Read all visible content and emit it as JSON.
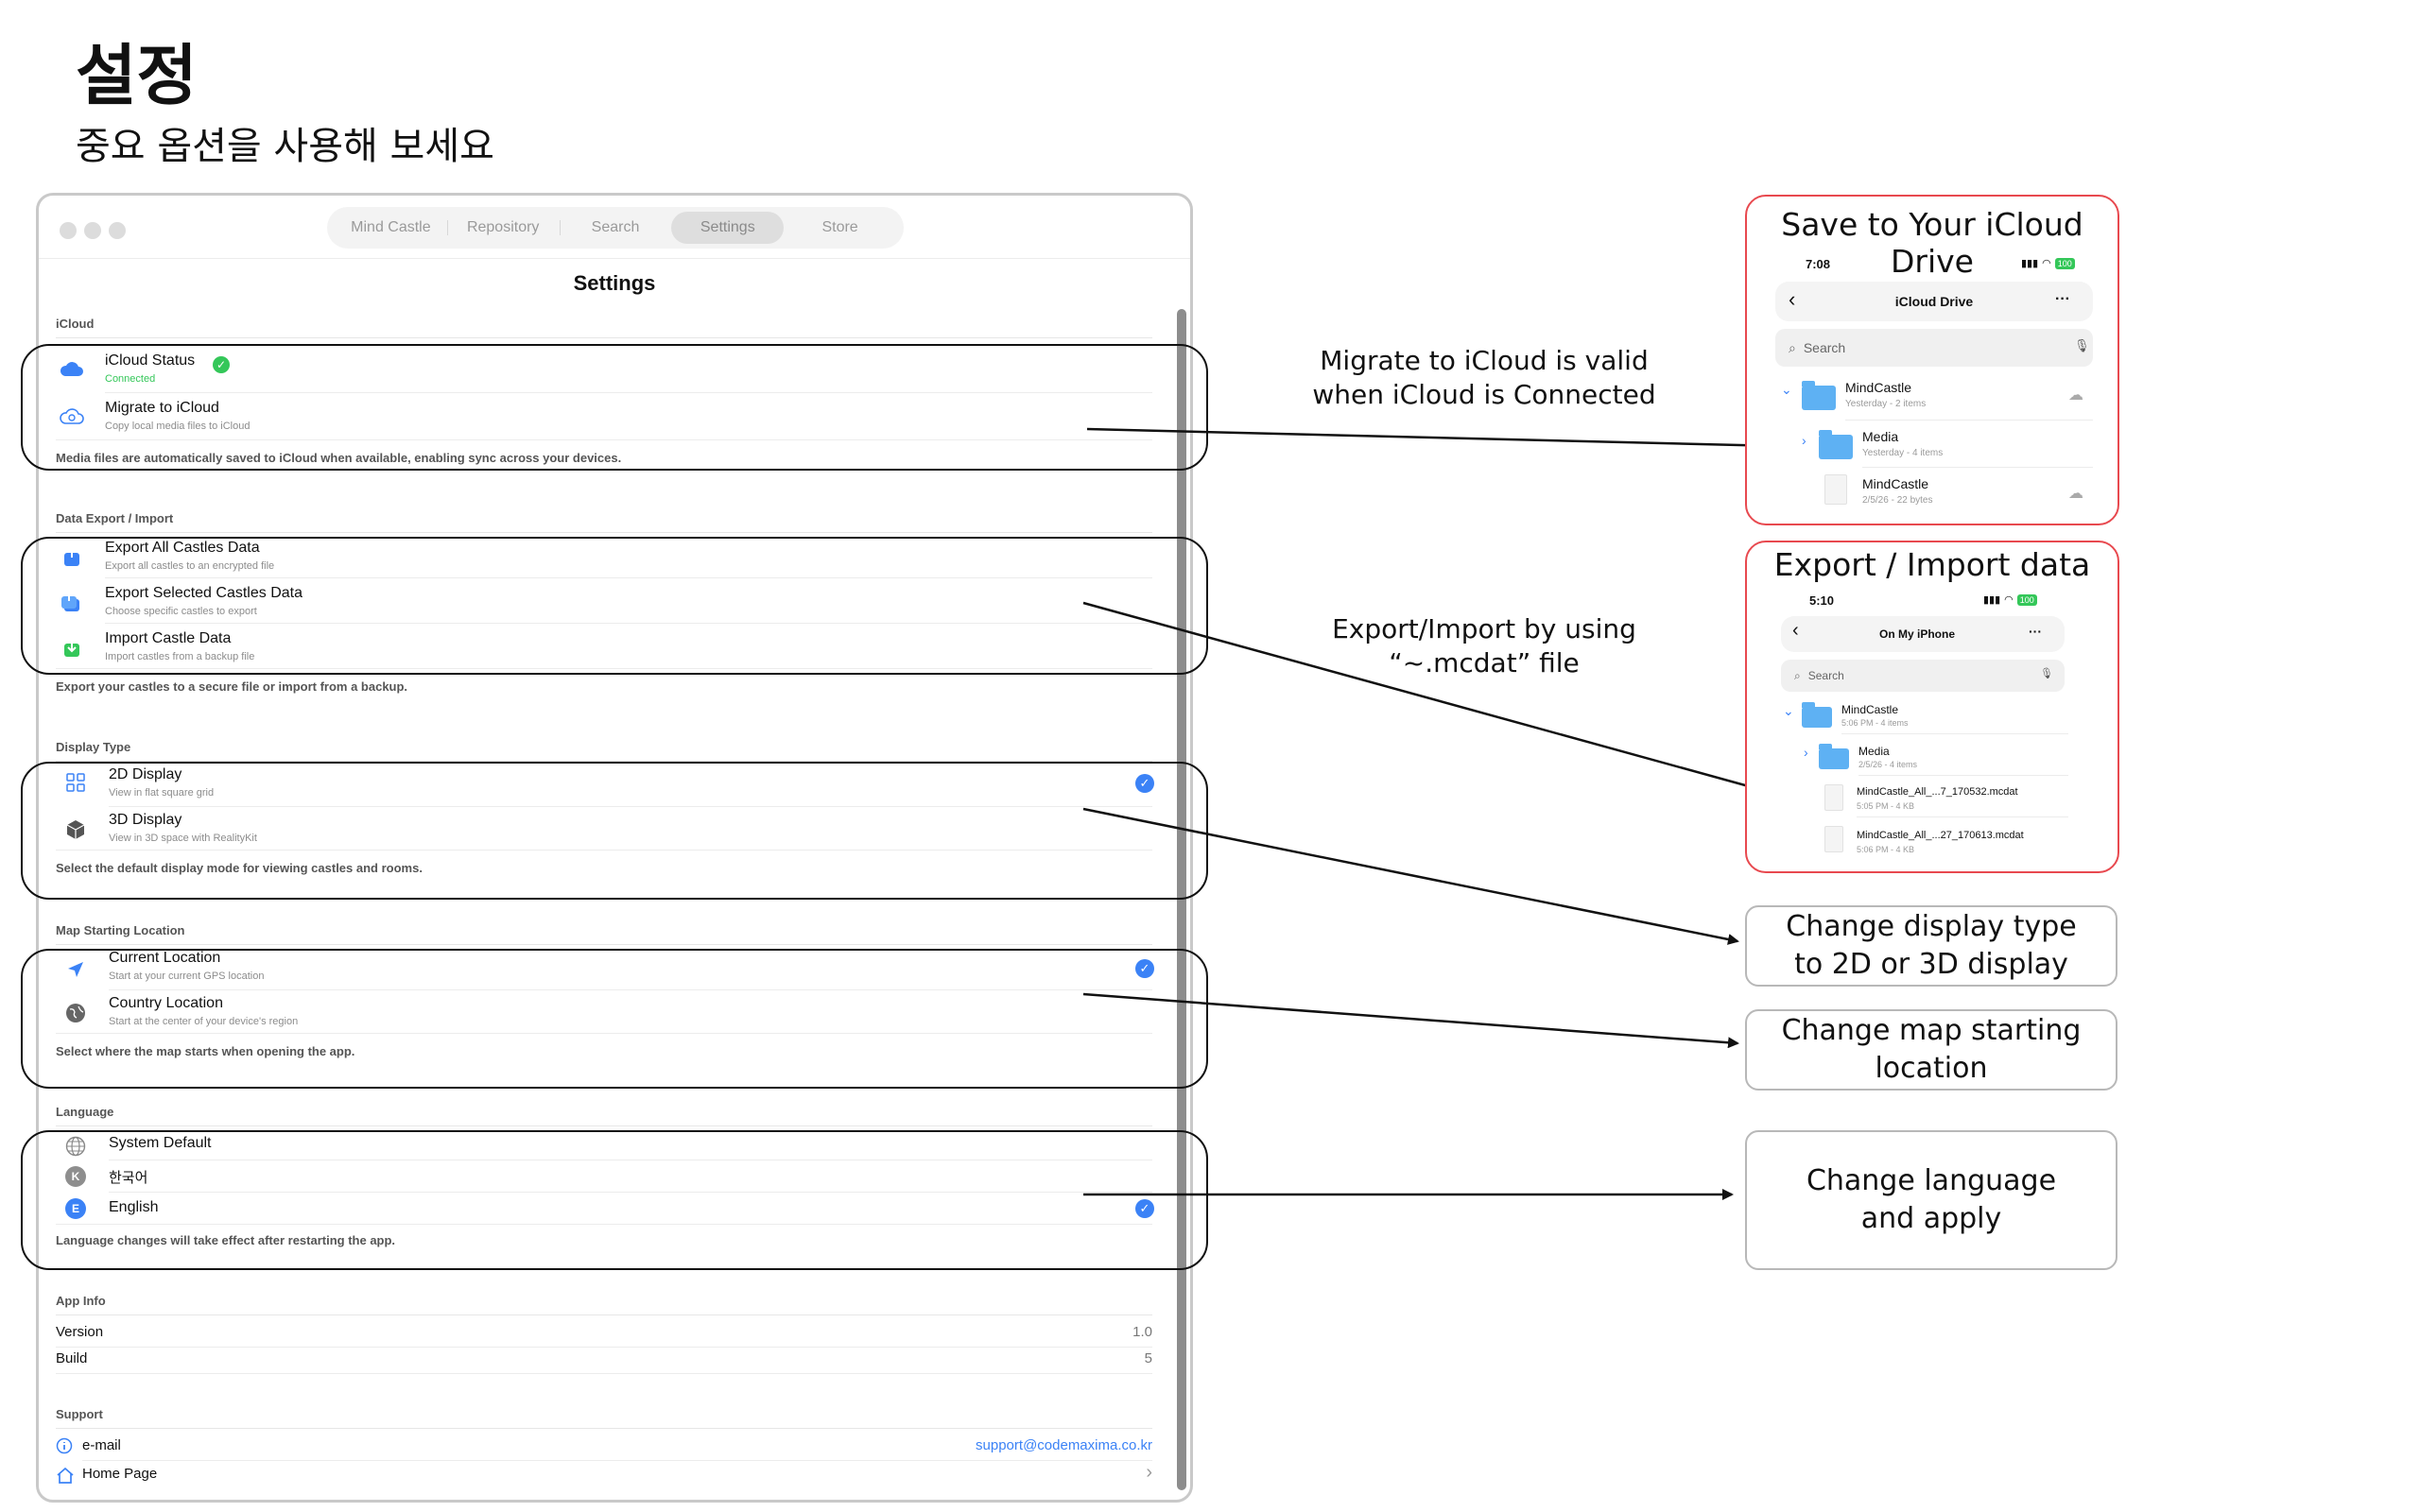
{
  "page": {
    "title": "설정",
    "subtitle": "중요 옵션을 사용해 보세요"
  },
  "window": {
    "tabs": [
      {
        "label": "Mind Castle",
        "active": false
      },
      {
        "label": "Repository",
        "active": false
      },
      {
        "label": "Search",
        "active": false
      },
      {
        "label": "Settings",
        "active": true
      },
      {
        "label": "Store",
        "active": false
      }
    ],
    "title": "Settings",
    "sections": {
      "icloud": {
        "header": "iCloud",
        "status_label": "iCloud Status",
        "status_value": "Connected",
        "migrate_label": "Migrate to iCloud",
        "migrate_sub": "Copy local media files to iCloud",
        "note": "Media files are automatically saved to iCloud when available, enabling sync across your devices."
      },
      "export": {
        "header": "Data Export / Import",
        "items": [
          {
            "label": "Export All Castles Data",
            "sub": "Export all castles to an encrypted file"
          },
          {
            "label": "Export Selected Castles Data",
            "sub": "Choose specific castles to export"
          },
          {
            "label": "Import Castle Data",
            "sub": "Import castles from a backup file"
          }
        ],
        "note": "Export your castles to a secure file or import from a backup."
      },
      "display": {
        "header": "Display Type",
        "items": [
          {
            "label": "2D Display",
            "sub": "View in flat square grid",
            "selected": true
          },
          {
            "label": "3D Display",
            "sub": "View in 3D space with RealityKit",
            "selected": false
          }
        ],
        "note": "Select the default display mode for viewing castles and rooms."
      },
      "map": {
        "header": "Map Starting Location",
        "items": [
          {
            "label": "Current Location",
            "sub": "Start at your current GPS location",
            "selected": true
          },
          {
            "label": "Country Location",
            "sub": "Start at the center of your device's region",
            "selected": false
          }
        ],
        "note": "Select where the map starts when opening the app."
      },
      "language": {
        "header": "Language",
        "items": [
          {
            "label": "System Default",
            "selected": false,
            "badge": ""
          },
          {
            "label": "한국어",
            "selected": false,
            "badge": "K"
          },
          {
            "label": "English",
            "selected": true,
            "badge": "E"
          }
        ],
        "note": "Language changes will take effect after restarting the app."
      },
      "appinfo": {
        "header": "App Info",
        "version_label": "Version",
        "version_value": "1.0",
        "build_label": "Build",
        "build_value": "5"
      },
      "support": {
        "header": "Support",
        "email_label": "e-mail",
        "email_value": "support@codemaxima.co.kr",
        "home_label": "Home Page",
        "home_chevron": "›"
      }
    }
  },
  "annotations": {
    "migrate_note": "Migrate to iCloud is valid\nwhen iCloud is Connected",
    "export_note": "Export/Import by using\n“~.mcdat” file",
    "display_box": "Change display type\nto 2D or 3D display",
    "map_box": "Change map starting\nlocation",
    "language_box": "Change language\nand apply"
  },
  "phone_icloud": {
    "title": "Save to Your iCloud Drive",
    "time": "7:08",
    "battery": "100",
    "nav_title": "iCloud Drive",
    "more": "···",
    "search": "Search",
    "rows": [
      {
        "name": "MindCastle",
        "sub": "Yesterday - 2 items"
      },
      {
        "name": "Media",
        "sub": "Yesterday - 4 items"
      },
      {
        "name": "MindCastle",
        "sub": "2/5/26 - 22 bytes"
      }
    ]
  },
  "phone_local": {
    "title": "Export / Import data",
    "time": "5:10",
    "battery": "100",
    "nav_title": "On My iPhone",
    "more": "···",
    "search": "Search",
    "rows": [
      {
        "name": "MindCastle",
        "sub": "5:06 PM - 4 items"
      },
      {
        "name": "Media",
        "sub": "2/5/26 - 4 items"
      },
      {
        "name": "MindCastle_All_...7_170532.mcdat",
        "sub": "5:05 PM - 4 KB"
      },
      {
        "name": "MindCastle_All_...27_170613.mcdat",
        "sub": "5:06 PM - 4 KB"
      }
    ]
  },
  "colors": {
    "accent": "#3b82f6",
    "annotation_red": "#e8494f",
    "connected_green": "#34c759"
  }
}
